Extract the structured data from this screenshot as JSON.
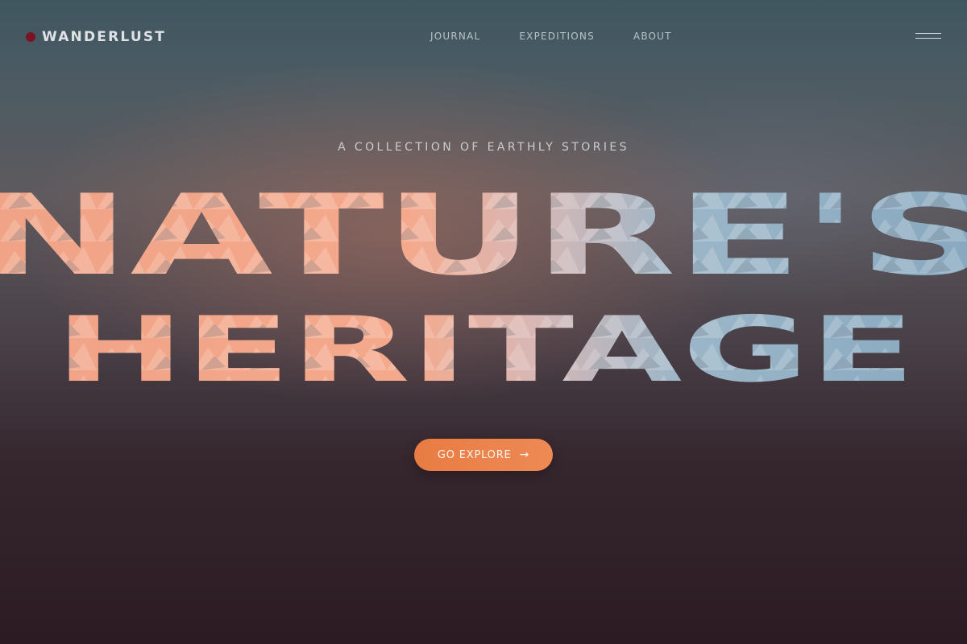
{
  "brand": {
    "name": "WANDERLUST"
  },
  "nav": {
    "items": [
      "JOURNAL",
      "EXPEDITIONS",
      "ABOUT"
    ]
  },
  "hero": {
    "tagline": "A COLLECTION OF EARTHLY STORIES",
    "line1": "NATURE'S",
    "line2": "HERITAGE"
  },
  "cta": {
    "label": "GO EXPLORE",
    "icon": "arrow-right-icon"
  },
  "colors": {
    "accent": "#e8824a",
    "logo_dot": "#7a1322",
    "peach_text": "#f2a787",
    "ice_text": "#8fb1c6"
  }
}
